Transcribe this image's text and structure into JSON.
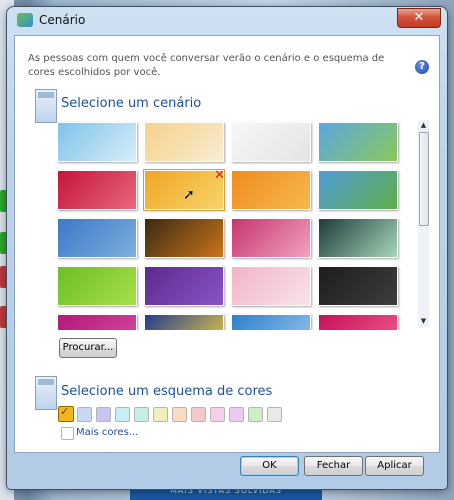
{
  "window": {
    "title": "Cenário",
    "close_label": "✕"
  },
  "description": "As pessoas com quem você conversar verão o cenário e o esquema de cores escolhidos por você.",
  "help_label": "?",
  "scene_section": {
    "title": "Selecione um cenário",
    "browse_button": "Procurar...",
    "thumbnails": [
      {
        "colors": [
          "#7fc2ea",
          "#d7eef9"
        ],
        "style": "sky"
      },
      {
        "colors": [
          "#f6d18c",
          "#f7ecd1"
        ],
        "style": "dots"
      },
      {
        "colors": [
          "#f7f7f7",
          "#e4e4e4"
        ],
        "style": "white"
      },
      {
        "colors": [
          "#59a7e0",
          "#8cc85a"
        ],
        "style": "field"
      },
      {
        "colors": [
          "#c4143d",
          "#e9677b"
        ],
        "style": "red"
      },
      {
        "colors": [
          "#f2a623",
          "#f7d36c"
        ],
        "style": "gold"
      },
      {
        "colors": [
          "#f08d1d",
          "#f6b850"
        ],
        "style": "orange"
      },
      {
        "colors": [
          "#4f9bd8",
          "#5fae45"
        ],
        "style": "green"
      },
      {
        "colors": [
          "#3b78c6",
          "#7faedf"
        ],
        "style": "blue"
      },
      {
        "colors": [
          "#3b2a12",
          "#c8741c"
        ],
        "style": "autumn"
      },
      {
        "colors": [
          "#c6356f",
          "#f3a2c2"
        ],
        "style": "pink"
      },
      {
        "colors": [
          "#1f3c3a",
          "#a6d6b8"
        ],
        "style": "teal"
      },
      {
        "colors": [
          "#6cbe23",
          "#a7df4d"
        ],
        "style": "lime"
      },
      {
        "colors": [
          "#5b2a8d",
          "#8b53c6"
        ],
        "style": "purple"
      },
      {
        "colors": [
          "#f1b4c6",
          "#f9e3ea"
        ],
        "style": "rose"
      },
      {
        "colors": [
          "#1d1d1d",
          "#3d3d3d"
        ],
        "style": "black"
      },
      {
        "colors": [
          "#b2197a",
          "#d84aa5"
        ],
        "style": "magenta"
      },
      {
        "colors": [
          "#233c8c",
          "#f0d040"
        ],
        "style": "navy"
      },
      {
        "colors": [
          "#2d80cc",
          "#9cc5ea"
        ],
        "style": "blue2"
      },
      {
        "colors": [
          "#c8105a",
          "#ef5d8f"
        ],
        "style": "crimson"
      }
    ],
    "selected_index": 5
  },
  "color_section": {
    "title": "Selecione um esquema de cores",
    "swatches": [
      "#f3b51b",
      "#c9d8f2",
      "#c9c5f3",
      "#c8eef5",
      "#c5f1e4",
      "#f1f0bd",
      "#f6dcc4",
      "#f3c8c8",
      "#f5cfe7",
      "#ecc9f3",
      "#ccf0c4",
      "#e9e9e9"
    ],
    "checked_index": 0,
    "more_colors_label": "Mais cores..."
  },
  "buttons": {
    "ok": "OK",
    "close": "Fechar",
    "apply": "Aplicar"
  },
  "background": {
    "bottom_text": "MAIS VISTAS SOLVIDAS"
  }
}
